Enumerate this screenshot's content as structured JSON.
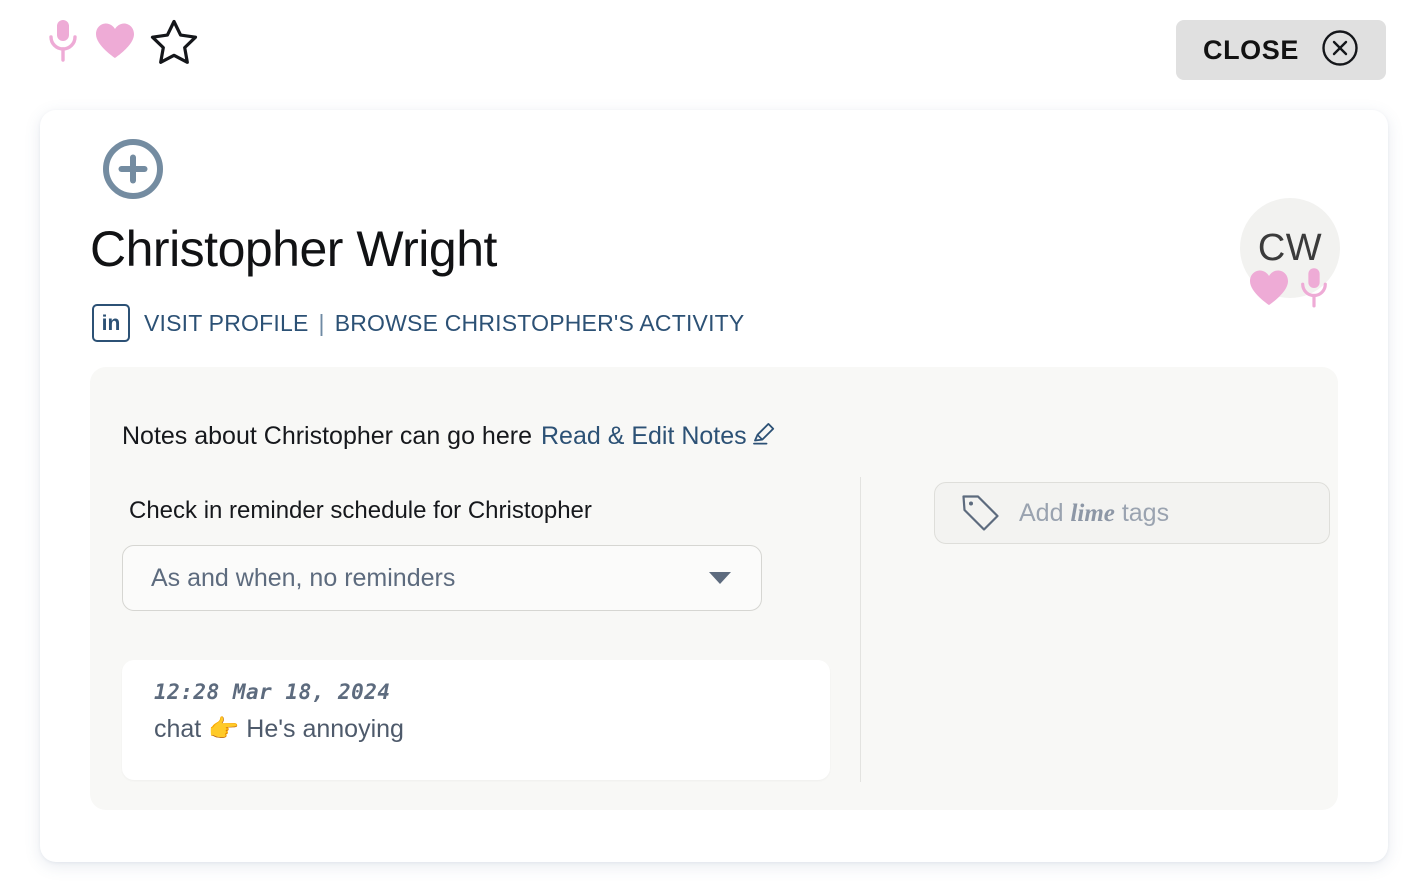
{
  "topbar": {
    "icons": [
      {
        "name": "microphone-icon",
        "label": "microphone"
      },
      {
        "name": "heart-icon",
        "label": "heart"
      },
      {
        "name": "star-outline-icon",
        "label": "star"
      }
    ],
    "close_label": "CLOSE",
    "close_icon": "close-circle-icon"
  },
  "profile": {
    "add_icon": "plus-circle-icon",
    "name": "Christopher Wright",
    "linkedin_badge": "in",
    "visit_profile_label": "VISIT PROFILE",
    "separator": "|",
    "browse_activity_label": "BROWSE CHRISTOPHER'S ACTIVITY",
    "avatar_initials": "CW",
    "avatar_icons": [
      {
        "name": "heart-icon",
        "label": "heart"
      },
      {
        "name": "microphone-icon",
        "label": "microphone"
      }
    ]
  },
  "notes": {
    "static_text": "Notes about Christopher can go here",
    "link_label": "Read & Edit Notes",
    "edit_icon": "pencil-icon"
  },
  "reminder": {
    "label": "Check in reminder schedule for Christopher",
    "selected_option": "As and when, no reminders",
    "caret_icon": "chevron-down-icon"
  },
  "tags": {
    "icon": "tag-icon",
    "placeholder_prefix": "Add ",
    "placeholder_emphasis": "lime",
    "placeholder_suffix": " tags"
  },
  "note_entries": [
    {
      "timestamp": "12:28 Mar 18, 2024",
      "body": "chat 👉 He's annoying"
    }
  ],
  "colors": {
    "pink": "#eeabd6",
    "slate_link": "#2c5175",
    "muted": "#5d6b7e",
    "panel_bg": "#f8f8f6",
    "close_bg": "#e0e0e0"
  }
}
